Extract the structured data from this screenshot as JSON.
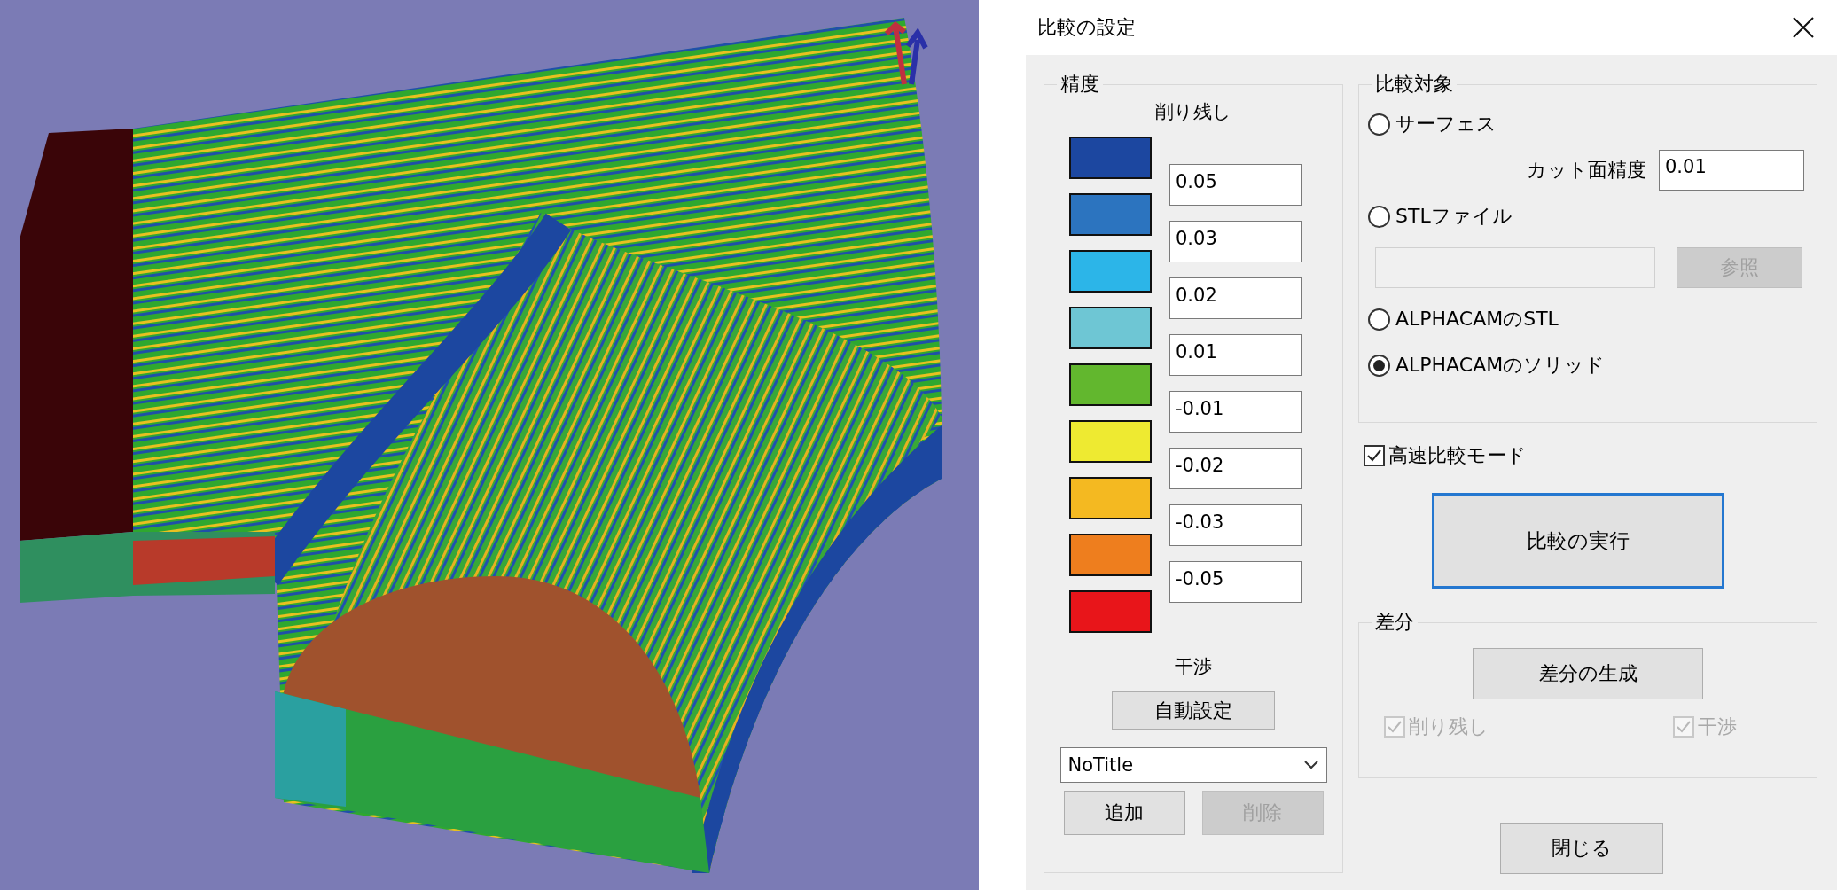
{
  "dialog": {
    "title": "比較の設定"
  },
  "precision": {
    "title": "精度",
    "header": "削り残し",
    "swatches": [
      {
        "color": "#1c47a0"
      },
      {
        "color": "#2c74bf"
      },
      {
        "color": "#2cb5e8"
      },
      {
        "color": "#6ec6d4"
      },
      {
        "color": "#62b72e"
      },
      {
        "color": "#eeea31"
      },
      {
        "color": "#f4b921"
      },
      {
        "color": "#ee7e1e"
      },
      {
        "color": "#e8151a"
      }
    ],
    "thresholds": [
      "0.05",
      "0.03",
      "0.02",
      "0.01",
      "-0.01",
      "-0.02",
      "-0.03",
      "-0.05"
    ],
    "interference_label": "干渉",
    "auto_button": {
      "label": "自動設定",
      "disabled": false
    },
    "profile": {
      "value": "NoTitle"
    },
    "add_button": {
      "label": "追加",
      "disabled": false
    },
    "delete_button": {
      "label": "削除",
      "disabled": true
    }
  },
  "target": {
    "title": "比較対象",
    "items": [
      {
        "kind": "radio",
        "label": "サーフェス",
        "selected": false
      },
      {
        "kind": "field",
        "label": "カット面精度",
        "value": "0.01"
      },
      {
        "kind": "radio",
        "label": "STLファイル",
        "selected": false
      },
      {
        "kind": "file",
        "field_disabled": true,
        "button": {
          "label": "参照",
          "disabled": true
        }
      },
      {
        "kind": "radio",
        "label": "ALPHACAMのSTL",
        "selected": false
      },
      {
        "kind": "radio",
        "label": "ALPHACAMのソリッド",
        "selected": true
      }
    ]
  },
  "fast_mode": {
    "label": "高速比較モード",
    "checked": true
  },
  "run_button": {
    "label": "比較の実行",
    "focused": true
  },
  "diff": {
    "title": "差分",
    "generate_button": {
      "label": "差分の生成",
      "disabled": false
    },
    "checkboxes": [
      {
        "label": "削り残し",
        "checked": true,
        "disabled": true
      },
      {
        "label": "干渉",
        "checked": true,
        "disabled": true
      }
    ]
  },
  "close_button": {
    "label": "閉じる",
    "disabled": false
  }
}
